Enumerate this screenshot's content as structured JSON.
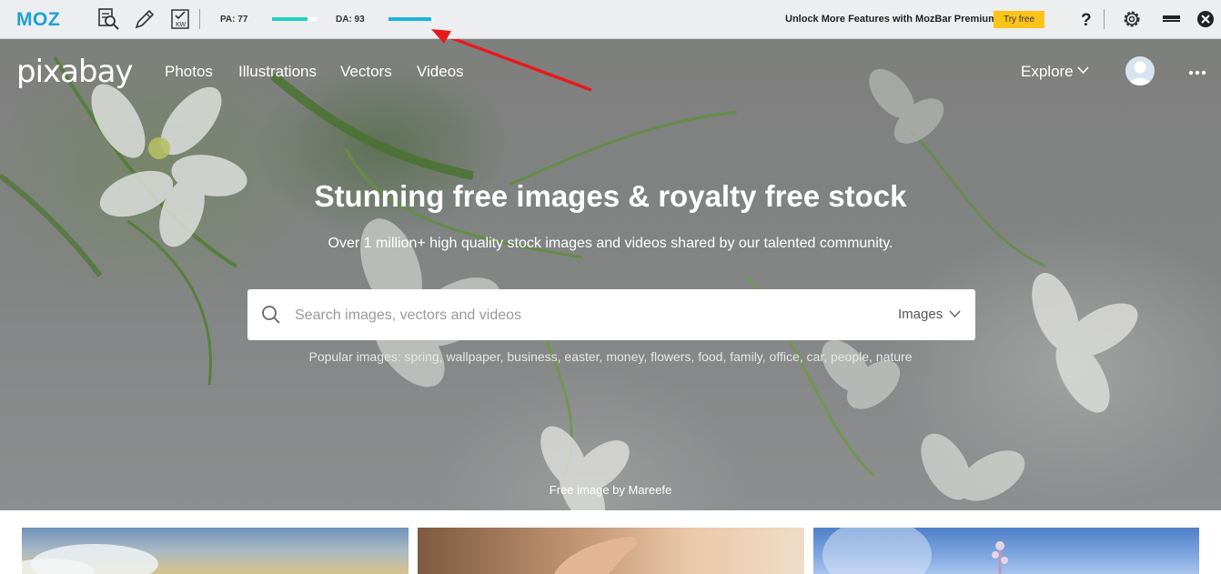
{
  "mozbar": {
    "logo": "MOZ",
    "tools": [
      "page-analysis-icon",
      "edit-pencil-icon",
      "keyword-checklist-icon"
    ],
    "pa_label": "PA: 77",
    "pa_value": 77,
    "da_label": "DA: 93",
    "da_value": 93,
    "promo_text": "Unlock More Features with MozBar Premium",
    "try_label": "Try free",
    "icons": [
      "help-icon",
      "settings-gear-icon",
      "minimize-icon",
      "close-icon"
    ],
    "colors": {
      "accent": "#1fa0d8",
      "pa_fill": "#20d0c0",
      "da_fill": "#1cb4e0",
      "try_bg": "#fcc419"
    }
  },
  "header": {
    "logo": "pixabay",
    "nav": [
      {
        "label": "Photos"
      },
      {
        "label": "Illustrations"
      },
      {
        "label": "Vectors"
      },
      {
        "label": "Videos"
      }
    ],
    "explore_label": "Explore",
    "icons": [
      "chevron-down-icon",
      "avatar-icon",
      "more-dots-icon"
    ]
  },
  "hero": {
    "title": "Stunning free images & royalty free stock",
    "subtitle": "Over 1 million+ high quality stock images and videos shared by our talented community.",
    "search": {
      "placeholder": "Search images, vectors and videos",
      "value": "",
      "type_selected": "Images"
    },
    "popular_text": "Popular images: spring, wallpaper, business, easter, money, flowers, food, family, office, car, people, nature",
    "credit": "Free image by Mareefe"
  },
  "annotation": {
    "arrow_color": "#e8191e"
  }
}
